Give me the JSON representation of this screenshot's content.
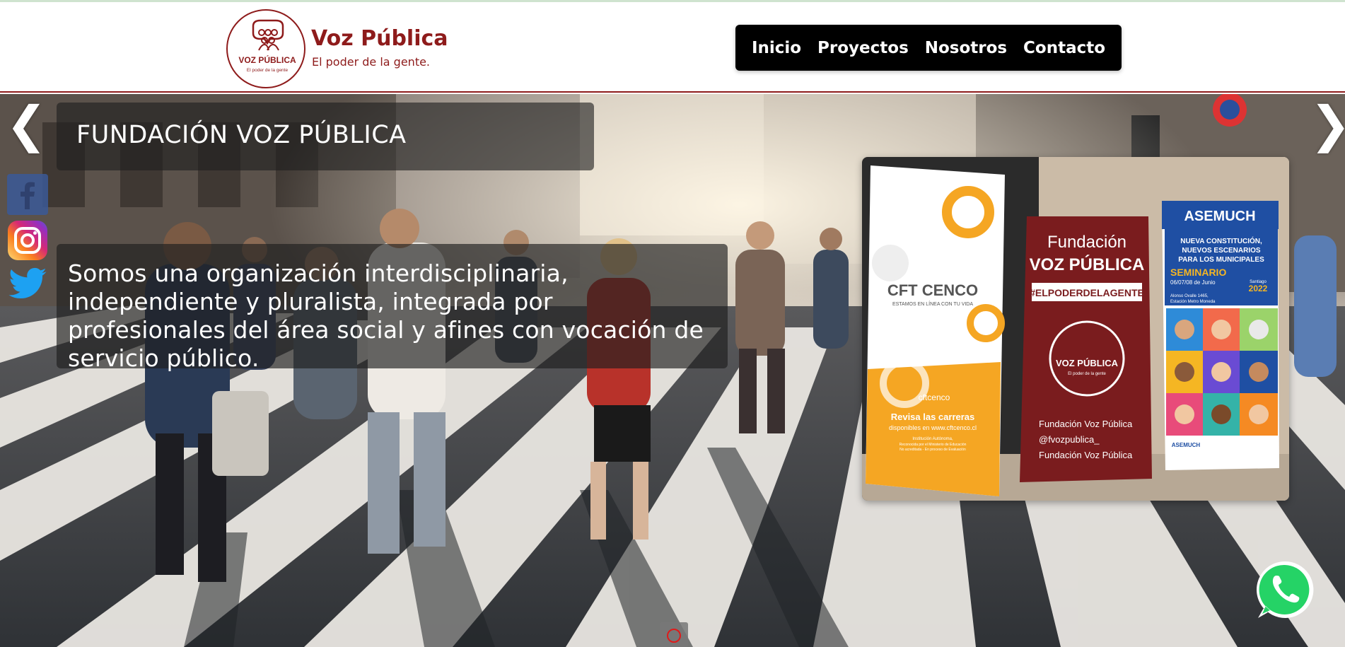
{
  "brand": {
    "logo_label": "VOZ PÚBLICA",
    "logo_sublabel": "El poder de la gente",
    "title": "Voz Pública",
    "tagline": "El poder de la gente.",
    "color": "#8e1b1b"
  },
  "nav": {
    "items": [
      {
        "label": "Inicio"
      },
      {
        "label": "Proyectos"
      },
      {
        "label": "Nosotros"
      },
      {
        "label": "Contacto"
      }
    ]
  },
  "hero": {
    "title": "FUNDACIÓN VOZ PÚBLICA",
    "description": "Somos una organización interdisciplinaria, independiente y pluralista, integrada por profesionales del área social y afines con vocación de servicio público.",
    "prev_icon": "chevron-left-icon",
    "next_icon": "chevron-right-icon",
    "prev_glyph": "❮",
    "next_glyph": "❯"
  },
  "social": [
    {
      "name": "facebook-icon",
      "color": "#3b5998"
    },
    {
      "name": "instagram-icon",
      "color": "#c13584"
    },
    {
      "name": "twitter-icon",
      "color": "#1da1f2"
    }
  ],
  "photo": {
    "banner1": {
      "brand": "CFT CENCO",
      "slogan": "ESTAMOS EN LÍNEA CON TU VIDA",
      "logo_text": "cftcenco",
      "cta": "Revisa las carreras",
      "cta_sub": "disponibles en www.cftcenco.cl",
      "note1": "Institución Autónoma,",
      "note2": "Reconocida por el Ministerio de Educación",
      "note3": "No acreditada - En proceso de Evaluación"
    },
    "banner2": {
      "line1": "Fundación",
      "line2": "VOZ PÚBLICA",
      "hashtag": "#ELPODERDELAGENTE",
      "logo_label": "VOZ PÚBLICA",
      "logo_sub": "El poder de la gente",
      "fb": "Fundación Voz Pública",
      "ig": "@fvozpublica_",
      "in": "Fundación Voz Pública"
    },
    "banner3": {
      "org": "ASEMUCH",
      "headline1": "NUEVA CONSTITUCIÓN,",
      "headline2": "NUEVOS ESCENARIOS",
      "headline3": "PARA LOS MUNICIPALES",
      "event": "SEMINARIO",
      "dates": "06/07/08 de Junio",
      "city": "Santiago",
      "year": "2022",
      "venue1": "Alonso Ovalle 1465,",
      "venue2": "Estación Metro Moneda",
      "footer_org": "ASEMUCH"
    }
  },
  "whatsapp": {
    "icon": "whatsapp-icon",
    "color": "#25d366"
  },
  "carousel": {
    "indicator_icon": "circle-indicator-icon"
  }
}
